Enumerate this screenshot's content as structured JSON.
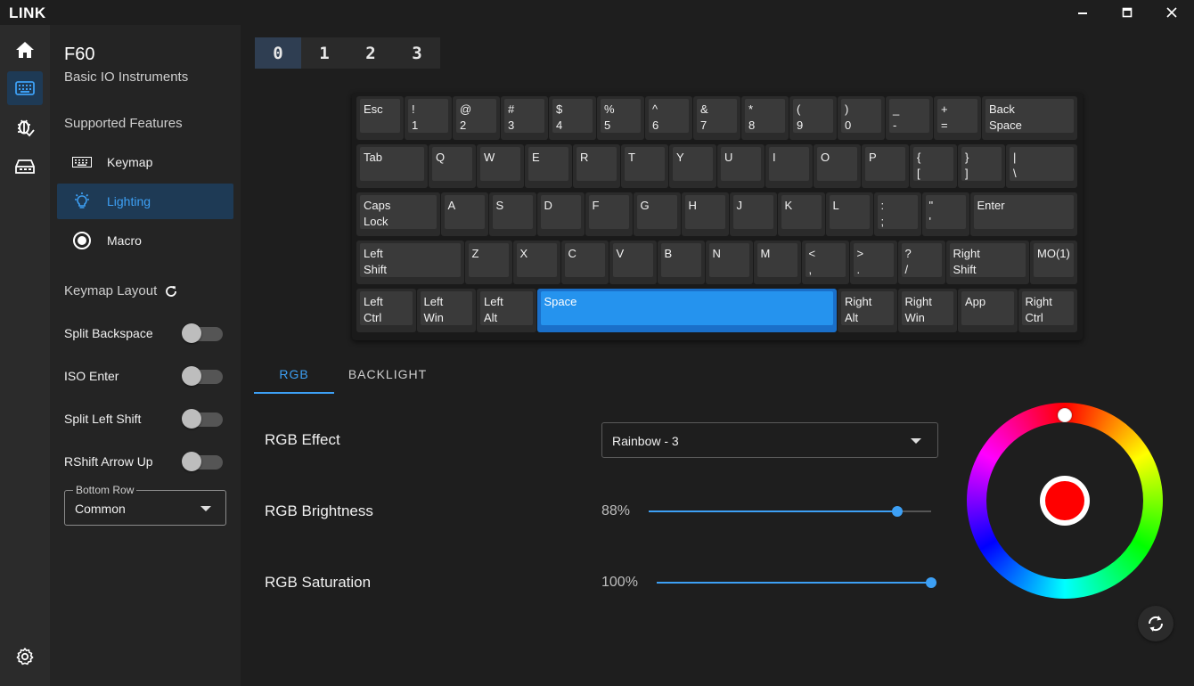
{
  "app": {
    "title": "LINK"
  },
  "colors": {
    "accent": "#3da0f5",
    "selected_key": "#2593ee",
    "selected_color": "#ff0000"
  },
  "rail": {
    "items": [
      {
        "icon": "home-icon"
      },
      {
        "icon": "keyboard-icon",
        "active": true
      },
      {
        "icon": "bug-check-icon"
      },
      {
        "icon": "keyboard-tray-icon"
      }
    ],
    "bottom_icon": "gear-icon"
  },
  "device": {
    "name": "F60",
    "vendor": "Basic IO Instruments"
  },
  "features": {
    "title": "Supported Features",
    "items": [
      {
        "label": "Keymap",
        "icon": "keyboard-icon"
      },
      {
        "label": "Lighting",
        "icon": "lightbulb-icon",
        "active": true
      },
      {
        "label": "Macro",
        "icon": "record-icon"
      }
    ]
  },
  "layout": {
    "title": "Keymap Layout",
    "toggles": [
      {
        "label": "Split Backspace",
        "on": false
      },
      {
        "label": "ISO Enter",
        "on": false
      },
      {
        "label": "Split Left Shift",
        "on": false
      },
      {
        "label": "RShift Arrow Up",
        "on": false
      }
    ],
    "bottom_row": {
      "legend": "Bottom Row",
      "value": "Common"
    }
  },
  "layers": [
    "0",
    "1",
    "2",
    "3"
  ],
  "active_layer": "0",
  "keyboard": {
    "rows": [
      [
        [
          "Esc",
          ""
        ],
        [
          "!",
          "1"
        ],
        [
          "@",
          "2"
        ],
        [
          "#",
          "3"
        ],
        [
          "$",
          "4"
        ],
        [
          "%",
          "5"
        ],
        [
          "^",
          "6"
        ],
        [
          "&",
          "7"
        ],
        [
          "*",
          "8"
        ],
        [
          "(",
          "9"
        ],
        [
          ")",
          "0"
        ],
        [
          "_",
          "-"
        ],
        [
          "+",
          "="
        ],
        [
          "Back",
          "Space"
        ]
      ],
      [
        [
          "Tab",
          ""
        ],
        [
          "Q",
          ""
        ],
        [
          "W",
          ""
        ],
        [
          "E",
          ""
        ],
        [
          "R",
          ""
        ],
        [
          "T",
          ""
        ],
        [
          "Y",
          ""
        ],
        [
          "U",
          ""
        ],
        [
          "I",
          ""
        ],
        [
          "O",
          ""
        ],
        [
          "P",
          ""
        ],
        [
          "{",
          "["
        ],
        [
          "}",
          "]"
        ],
        [
          "|",
          "\\"
        ]
      ],
      [
        [
          "Caps",
          "Lock"
        ],
        [
          "A",
          ""
        ],
        [
          "S",
          ""
        ],
        [
          "D",
          ""
        ],
        [
          "F",
          ""
        ],
        [
          "G",
          ""
        ],
        [
          "H",
          ""
        ],
        [
          "J",
          ""
        ],
        [
          "K",
          ""
        ],
        [
          "L",
          ""
        ],
        [
          ":",
          ";"
        ],
        [
          "\"",
          "'"
        ],
        [
          "Enter",
          ""
        ]
      ],
      [
        [
          "Left",
          "Shift"
        ],
        [
          "Z",
          ""
        ],
        [
          "X",
          ""
        ],
        [
          "C",
          ""
        ],
        [
          "V",
          ""
        ],
        [
          "B",
          ""
        ],
        [
          "N",
          ""
        ],
        [
          "M",
          ""
        ],
        [
          "<",
          ","
        ],
        [
          ">",
          "."
        ],
        [
          "?",
          "/"
        ],
        [
          "Right",
          "Shift"
        ],
        [
          "MO(1)",
          ""
        ]
      ],
      [
        [
          "Left",
          "Ctrl"
        ],
        [
          "Left",
          "Win"
        ],
        [
          "Left",
          "Alt"
        ],
        [
          "Space",
          ""
        ],
        [
          "Right",
          "Alt"
        ],
        [
          "Right",
          "Win"
        ],
        [
          "App",
          ""
        ],
        [
          "Right",
          "Ctrl"
        ]
      ]
    ],
    "selected_key": "Space"
  },
  "lighting": {
    "tabs": [
      "RGB",
      "BACKLIGHT"
    ],
    "active_tab": "RGB",
    "effect": {
      "label": "RGB Effect",
      "value": "Rainbow - 3"
    },
    "brightness": {
      "label": "RGB Brightness",
      "value_text": "88%",
      "value": 0.88
    },
    "saturation": {
      "label": "RGB Saturation",
      "value_text": "100%",
      "value": 1.0
    }
  }
}
